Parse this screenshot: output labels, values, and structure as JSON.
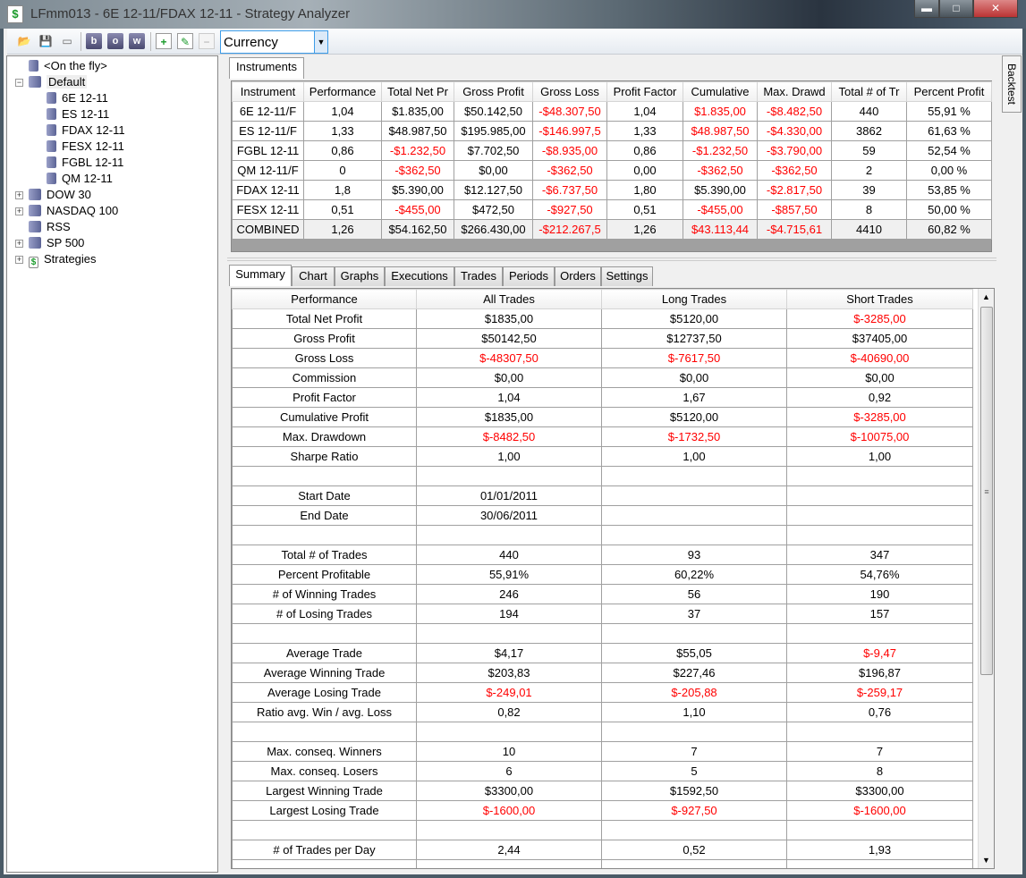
{
  "window": {
    "title": "LFmm013 - 6E 12-11/FDAX 12-11 - Strategy Analyzer",
    "minimize": "▬",
    "maximize": "□",
    "close": "✕"
  },
  "toolbar": {
    "buttons": [
      "open-folder-icon",
      "save-icon",
      "clear-icon",
      "b",
      "o",
      "w",
      "add-icon",
      "edit-icon",
      "remove-icon"
    ],
    "b_label": "b",
    "o_label": "o",
    "w_label": "w",
    "currency_value": "Currency"
  },
  "tree": {
    "items": [
      {
        "label": "<On the fly>",
        "level": 1,
        "expander": "",
        "kind": "db"
      },
      {
        "label": "Default",
        "level": 0,
        "expander": "−",
        "kind": "grp"
      },
      {
        "label": "6E 12-11",
        "level": 2,
        "expander": "",
        "kind": "db"
      },
      {
        "label": "ES 12-11",
        "level": 2,
        "expander": "",
        "kind": "db"
      },
      {
        "label": "FDAX 12-11",
        "level": 2,
        "expander": "",
        "kind": "db"
      },
      {
        "label": "FESX 12-11",
        "level": 2,
        "expander": "",
        "kind": "db"
      },
      {
        "label": "FGBL 12-11",
        "level": 2,
        "expander": "",
        "kind": "db"
      },
      {
        "label": "QM 12-11",
        "level": 2,
        "expander": "",
        "kind": "db"
      },
      {
        "label": "DOW 30",
        "level": 0,
        "expander": "+",
        "kind": "grp"
      },
      {
        "label": "NASDAQ 100",
        "level": 0,
        "expander": "+",
        "kind": "grp"
      },
      {
        "label": "RSS",
        "level": 0,
        "expander": "",
        "kind": "grp"
      },
      {
        "label": "SP 500",
        "level": 0,
        "expander": "+",
        "kind": "grp"
      },
      {
        "label": "Strategies",
        "level": 0,
        "expander": "+",
        "kind": "str"
      }
    ]
  },
  "instruments_tab": "Instruments",
  "backtest_tab": "Backtest",
  "instruments": {
    "columns": [
      "Instrument",
      "Performance",
      "Total Net Pr",
      "Gross Profit",
      "Gross Loss",
      "Profit Factor",
      "Cumulative",
      "Max. Drawd",
      "Total # of Tr",
      "Percent Profit"
    ],
    "rows": [
      [
        [
          "6E 12-11/F",
          0
        ],
        [
          "1,04",
          0
        ],
        [
          "$1.835,00",
          0
        ],
        [
          "$50.142,50",
          0
        ],
        [
          "-$48.307,50",
          1
        ],
        [
          "1,04",
          0
        ],
        [
          "$1.835,00",
          1
        ],
        [
          "-$8.482,50",
          1
        ],
        [
          "440",
          0
        ],
        [
          "55,91 %",
          0
        ]
      ],
      [
        [
          "ES 12-11/F",
          0
        ],
        [
          "1,33",
          0
        ],
        [
          "$48.987,50",
          0
        ],
        [
          "$195.985,00",
          0
        ],
        [
          "-$146.997,5",
          1
        ],
        [
          "1,33",
          0
        ],
        [
          "$48.987,50",
          1
        ],
        [
          "-$4.330,00",
          1
        ],
        [
          "3862",
          0
        ],
        [
          "61,63 %",
          0
        ]
      ],
      [
        [
          "FGBL 12-11",
          0
        ],
        [
          "0,86",
          0
        ],
        [
          "-$1.232,50",
          1
        ],
        [
          "$7.702,50",
          0
        ],
        [
          "-$8.935,00",
          1
        ],
        [
          "0,86",
          0
        ],
        [
          "-$1.232,50",
          1
        ],
        [
          "-$3.790,00",
          1
        ],
        [
          "59",
          0
        ],
        [
          "52,54 %",
          0
        ]
      ],
      [
        [
          "QM 12-11/F",
          0
        ],
        [
          "0",
          0
        ],
        [
          "-$362,50",
          1
        ],
        [
          "$0,00",
          0
        ],
        [
          "-$362,50",
          1
        ],
        [
          "0,00",
          0
        ],
        [
          "-$362,50",
          1
        ],
        [
          "-$362,50",
          1
        ],
        [
          "2",
          0
        ],
        [
          "0,00 %",
          0
        ]
      ],
      [
        [
          "FDAX 12-11",
          0
        ],
        [
          "1,8",
          0
        ],
        [
          "$5.390,00",
          0
        ],
        [
          "$12.127,50",
          0
        ],
        [
          "-$6.737,50",
          1
        ],
        [
          "1,80",
          0
        ],
        [
          "$5.390,00",
          0
        ],
        [
          "-$2.817,50",
          1
        ],
        [
          "39",
          0
        ],
        [
          "53,85 %",
          0
        ]
      ],
      [
        [
          "FESX 12-11",
          0
        ],
        [
          "0,51",
          0
        ],
        [
          "-$455,00",
          1
        ],
        [
          "$472,50",
          0
        ],
        [
          "-$927,50",
          1
        ],
        [
          "0,51",
          0
        ],
        [
          "-$455,00",
          1
        ],
        [
          "-$857,50",
          1
        ],
        [
          "8",
          0
        ],
        [
          "50,00 %",
          0
        ]
      ],
      [
        [
          "COMBINED",
          0
        ],
        [
          "1,26",
          0
        ],
        [
          "$54.162,50",
          0
        ],
        [
          "$266.430,00",
          0
        ],
        [
          "-$212.267,5",
          1
        ],
        [
          "1,26",
          0
        ],
        [
          "$43.113,44",
          1
        ],
        [
          "-$4.715,61",
          1
        ],
        [
          "4410",
          0
        ],
        [
          "60,82 %",
          0
        ]
      ]
    ]
  },
  "tabs": [
    "Summary",
    "Chart",
    "Graphs",
    "Executions",
    "Trades",
    "Periods",
    "Orders",
    "Settings"
  ],
  "summary": {
    "columns": [
      "Performance",
      "All Trades",
      "Long Trades",
      "Short Trades"
    ],
    "rows": [
      [
        [
          "Total Net Profit",
          0
        ],
        [
          "$1835,00",
          0
        ],
        [
          "$5120,00",
          0
        ],
        [
          "$-3285,00",
          1
        ]
      ],
      [
        [
          "Gross Profit",
          0
        ],
        [
          "$50142,50",
          0
        ],
        [
          "$12737,50",
          0
        ],
        [
          "$37405,00",
          0
        ]
      ],
      [
        [
          "Gross Loss",
          0
        ],
        [
          "$-48307,50",
          1
        ],
        [
          "$-7617,50",
          1
        ],
        [
          "$-40690,00",
          1
        ]
      ],
      [
        [
          "Commission",
          0
        ],
        [
          "$0,00",
          0
        ],
        [
          "$0,00",
          0
        ],
        [
          "$0,00",
          0
        ]
      ],
      [
        [
          "Profit Factor",
          0
        ],
        [
          "1,04",
          0
        ],
        [
          "1,67",
          0
        ],
        [
          "0,92",
          0
        ]
      ],
      [
        [
          "Cumulative Profit",
          0
        ],
        [
          "$1835,00",
          0
        ],
        [
          "$5120,00",
          0
        ],
        [
          "$-3285,00",
          1
        ]
      ],
      [
        [
          "Max. Drawdown",
          0
        ],
        [
          "$-8482,50",
          1
        ],
        [
          "$-1732,50",
          1
        ],
        [
          "$-10075,00",
          1
        ]
      ],
      [
        [
          "Sharpe Ratio",
          0
        ],
        [
          "1,00",
          0
        ],
        [
          "1,00",
          0
        ],
        [
          "1,00",
          0
        ]
      ],
      [
        [
          "",
          0
        ],
        [
          "",
          0
        ],
        [
          "",
          0
        ],
        [
          "",
          0
        ]
      ],
      [
        [
          "Start Date",
          0
        ],
        [
          "01/01/2011",
          0
        ],
        [
          "",
          0
        ],
        [
          "",
          0
        ]
      ],
      [
        [
          "End Date",
          0
        ],
        [
          "30/06/2011",
          0
        ],
        [
          "",
          0
        ],
        [
          "",
          0
        ]
      ],
      [
        [
          "",
          0
        ],
        [
          "",
          0
        ],
        [
          "",
          0
        ],
        [
          "",
          0
        ]
      ],
      [
        [
          "Total # of Trades",
          0
        ],
        [
          "440",
          0
        ],
        [
          "93",
          0
        ],
        [
          "347",
          0
        ]
      ],
      [
        [
          "Percent Profitable",
          0
        ],
        [
          "55,91%",
          0
        ],
        [
          "60,22%",
          0
        ],
        [
          "54,76%",
          0
        ]
      ],
      [
        [
          "# of Winning Trades",
          0
        ],
        [
          "246",
          0
        ],
        [
          "56",
          0
        ],
        [
          "190",
          0
        ]
      ],
      [
        [
          "# of Losing Trades",
          0
        ],
        [
          "194",
          0
        ],
        [
          "37",
          0
        ],
        [
          "157",
          0
        ]
      ],
      [
        [
          "",
          0
        ],
        [
          "",
          0
        ],
        [
          "",
          0
        ],
        [
          "",
          0
        ]
      ],
      [
        [
          "Average Trade",
          0
        ],
        [
          "$4,17",
          0
        ],
        [
          "$55,05",
          0
        ],
        [
          "$-9,47",
          1
        ]
      ],
      [
        [
          "Average Winning Trade",
          0
        ],
        [
          "$203,83",
          0
        ],
        [
          "$227,46",
          0
        ],
        [
          "$196,87",
          0
        ]
      ],
      [
        [
          "Average Losing Trade",
          0
        ],
        [
          "$-249,01",
          1
        ],
        [
          "$-205,88",
          1
        ],
        [
          "$-259,17",
          1
        ]
      ],
      [
        [
          "Ratio avg. Win / avg. Loss",
          0
        ],
        [
          "0,82",
          0
        ],
        [
          "1,10",
          0
        ],
        [
          "0,76",
          0
        ]
      ],
      [
        [
          "",
          0
        ],
        [
          "",
          0
        ],
        [
          "",
          0
        ],
        [
          "",
          0
        ]
      ],
      [
        [
          "Max. conseq. Winners",
          0
        ],
        [
          "10",
          0
        ],
        [
          "7",
          0
        ],
        [
          "7",
          0
        ]
      ],
      [
        [
          "Max. conseq. Losers",
          0
        ],
        [
          "6",
          0
        ],
        [
          "5",
          0
        ],
        [
          "8",
          0
        ]
      ],
      [
        [
          "Largest Winning Trade",
          0
        ],
        [
          "$3300,00",
          0
        ],
        [
          "$1592,50",
          0
        ],
        [
          "$3300,00",
          0
        ]
      ],
      [
        [
          "Largest Losing Trade",
          0
        ],
        [
          "$-1600,00",
          1
        ],
        [
          "$-927,50",
          1
        ],
        [
          "$-1600,00",
          1
        ]
      ],
      [
        [
          "",
          0
        ],
        [
          "",
          0
        ],
        [
          "",
          0
        ],
        [
          "",
          0
        ]
      ],
      [
        [
          "# of Trades per Day",
          0
        ],
        [
          "2,44",
          0
        ],
        [
          "0,52",
          0
        ],
        [
          "1,93",
          0
        ]
      ],
      [
        [
          "",
          0
        ],
        [
          "",
          0
        ],
        [
          "",
          0
        ],
        [
          "",
          0
        ]
      ]
    ]
  },
  "colors": {
    "negative": "#ff0000",
    "accent": "#3c9ce8"
  }
}
